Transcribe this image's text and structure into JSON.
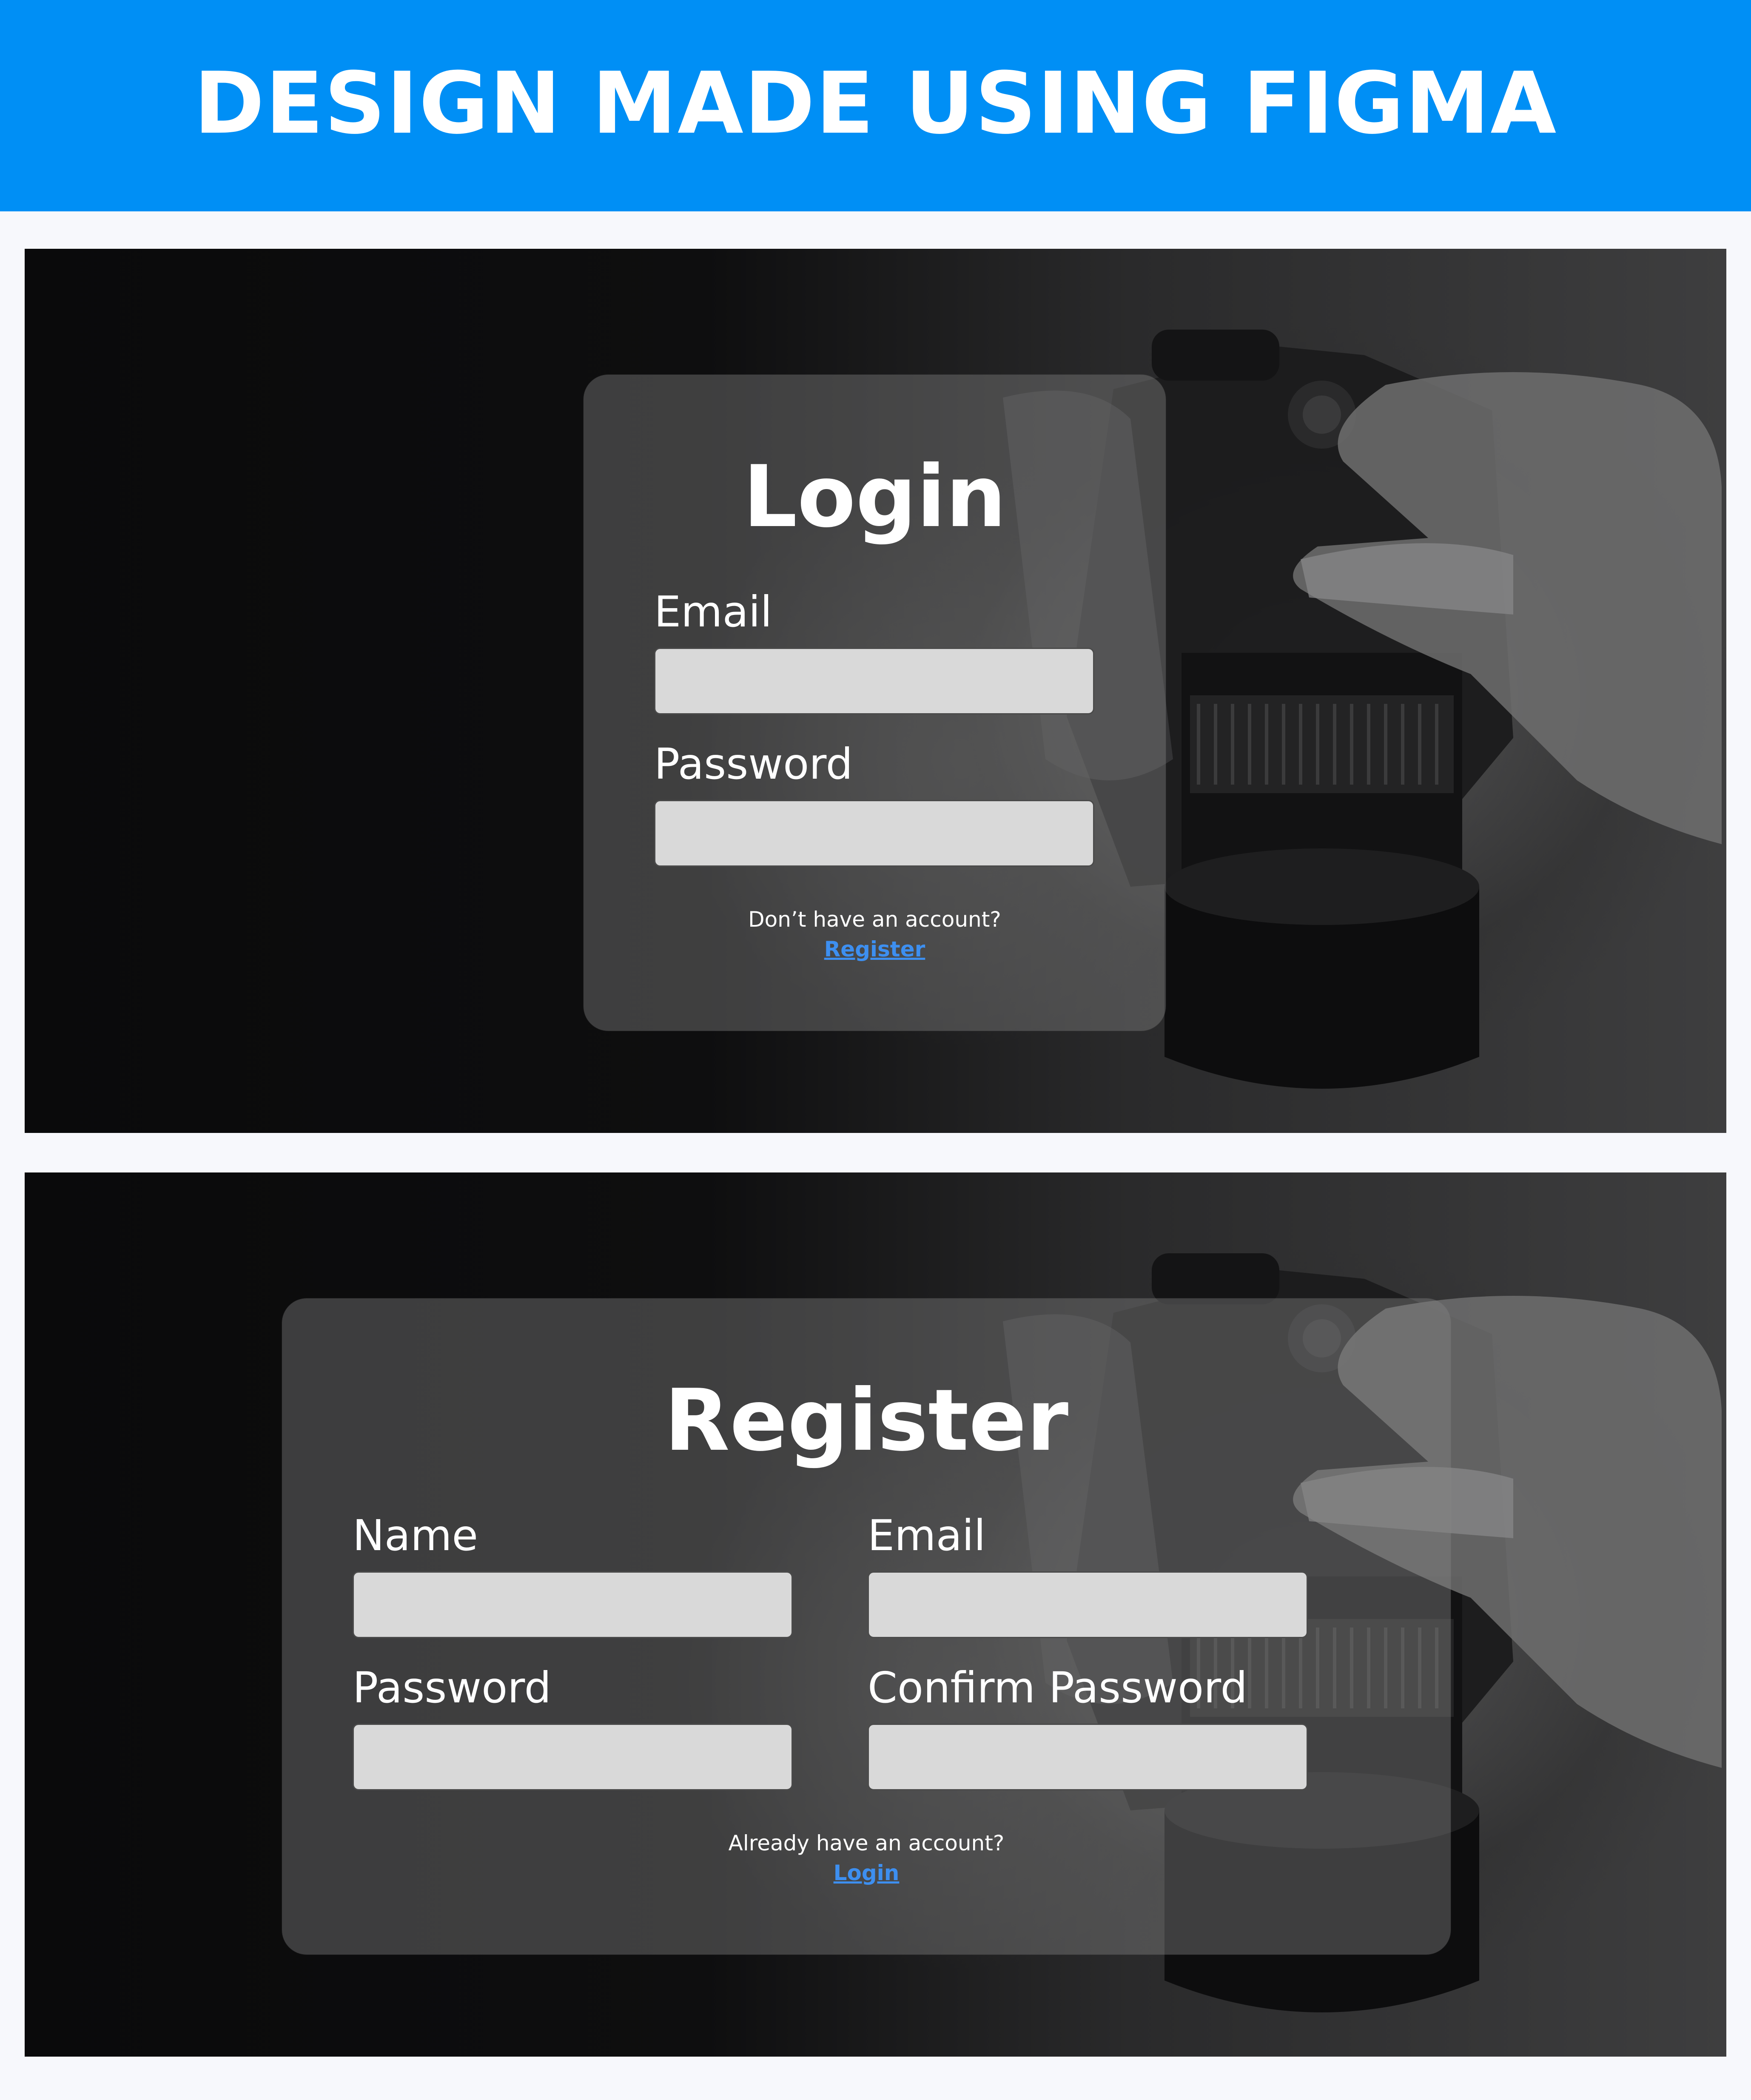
{
  "banner": {
    "title": "DESIGN MADE USING FIGMA",
    "color": "#008ff5"
  },
  "login": {
    "title": "Login",
    "email_label": "Email",
    "email_value": "",
    "password_label": "Password",
    "password_value": "",
    "prompt": "Don’t have an account?",
    "link": "Register"
  },
  "register": {
    "title": "Register",
    "name_label": "Name",
    "name_value": "",
    "email_label": "Email",
    "email_value": "",
    "password_label": "Password",
    "password_value": "",
    "confirm_label": "Confirm Password",
    "confirm_value": "",
    "prompt": "Already have an account?",
    "link": "Login"
  },
  "colors": {
    "link": "#3d8ff0",
    "input_fill": "#d9d9d9"
  }
}
